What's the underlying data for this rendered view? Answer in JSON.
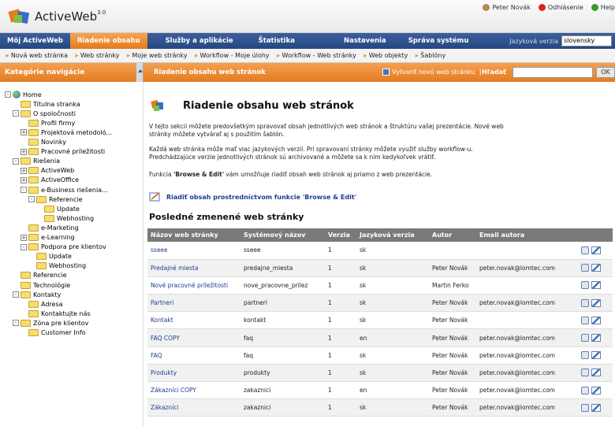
{
  "app": {
    "title": "ActiveWeb",
    "version": "3.0"
  },
  "user": {
    "name": "Peter Novák",
    "logout": "Odhlásenie",
    "help": "Help"
  },
  "main_nav": {
    "tabs": [
      "Môj ActiveWeb",
      "Riadenie obsahu",
      "Služby a aplikácie",
      "Štatistika",
      "Nastavenia",
      "Správa systému"
    ],
    "active": "Riadenie obsahu",
    "lang_label": "Jazyková verzia",
    "lang_value": "slovensky"
  },
  "sub_nav": [
    "Nová web stránka",
    "Web stránky",
    "Moje web stránky",
    "Workflow - Moje úlohy",
    "Workflow - Web stránky",
    "Web objekty",
    "Šablóny"
  ],
  "toolbar": {
    "sidebar_title": "Kategórie navigácie",
    "main_title": "Riadenie obsahu web stránok",
    "create_link": "Vytvoriť novú web stránku",
    "search_label": "Hľadať",
    "ok": "OK"
  },
  "tree": [
    {
      "label": "Home",
      "level": 0,
      "exp": "-"
    },
    {
      "label": "Titulna stranka",
      "level": 1,
      "exp": ""
    },
    {
      "label": "O spoločnosti",
      "level": 1,
      "exp": "-"
    },
    {
      "label": "Profil firmy",
      "level": 2,
      "exp": ""
    },
    {
      "label": "Projektová metodoló...",
      "level": 2,
      "exp": "+"
    },
    {
      "label": "Novinky",
      "level": 2,
      "exp": ""
    },
    {
      "label": "Pracovné príležitosti",
      "level": 2,
      "exp": "+"
    },
    {
      "label": "Riešenia",
      "level": 1,
      "exp": "-"
    },
    {
      "label": "ActiveWeb",
      "level": 2,
      "exp": "+"
    },
    {
      "label": "ActiveOffice",
      "level": 2,
      "exp": "+"
    },
    {
      "label": "e-Business riešenia...",
      "level": 2,
      "exp": "-"
    },
    {
      "label": "Referencie",
      "level": 3,
      "exp": "-"
    },
    {
      "label": "Update",
      "level": 4,
      "exp": ""
    },
    {
      "label": "Webhosting",
      "level": 4,
      "exp": ""
    },
    {
      "label": "e-Marketing",
      "level": 2,
      "exp": ""
    },
    {
      "label": "e-Learning",
      "level": 2,
      "exp": "+"
    },
    {
      "label": "Podpora pre klientov",
      "level": 2,
      "exp": "-"
    },
    {
      "label": "Update",
      "level": 3,
      "exp": ""
    },
    {
      "label": "Webhosting",
      "level": 3,
      "exp": ""
    },
    {
      "label": "Referencie",
      "level": 1,
      "exp": ""
    },
    {
      "label": "Technológie",
      "level": 1,
      "exp": ""
    },
    {
      "label": "Kontakty",
      "level": 1,
      "exp": "-"
    },
    {
      "label": "Adresa",
      "level": 2,
      "exp": ""
    },
    {
      "label": "Kontaktujte nás",
      "level": 2,
      "exp": ""
    },
    {
      "label": "Zóna pre klientov",
      "level": 1,
      "exp": "-"
    },
    {
      "label": "Customer Info",
      "level": 2,
      "exp": ""
    }
  ],
  "content": {
    "heading": "Riadenie obsahu web stránok",
    "p1": "V tejto sekcii môžete predovšetkým spravovať obsah jednotlivých web stránok a štruktúru vašej prezentácie. Nové web stránky môžete vytvárať aj s použitím šablón.",
    "p2": "Každá web stránka môže mať viac jazykových verzií. Pri spravovaní stránky môžete využiť služby workflow-u. Predchádzajúce verzie jednotlivých stránok sú archivované a môžete sa k nim kedykoľvek vrátiť.",
    "p3_pre": "Funkcia ",
    "p3_bold": "'Browse & Edit'",
    "p3_post": " vám umožňuje riadiť obsah web stránok aj priamo z web prezentácie.",
    "browse_link": "Riadiť obsah prostredníctvom funkcie 'Browse & Edit'",
    "recent_title": "Posledné zmenené web stránky"
  },
  "table": {
    "headers": [
      "Názov web stránky",
      "Systémový názov",
      "Verzia",
      "Jazyková verzia",
      "Autor",
      "Email autora"
    ],
    "rows": [
      [
        "sseee",
        "sseee",
        "1",
        "sk",
        "",
        ""
      ],
      [
        "Predajné miesta",
        "predajne_miesta",
        "1",
        "sk",
        "Peter Novák",
        "peter.novak@lomtec.com"
      ],
      [
        "Nové pracovné príležitosti",
        "nove_pracovne_prilez",
        "1",
        "sk",
        "Martin Ferko",
        ""
      ],
      [
        "Partneri",
        "partneri",
        "1",
        "sk",
        "Peter Novák",
        "peter.novak@lomtec.com"
      ],
      [
        "Kontakt",
        "kontakt",
        "1",
        "sk",
        "Peter Novák",
        ""
      ],
      [
        "FAQ COPY",
        "faq",
        "1",
        "en",
        "Peter Novák",
        "peter.novak@lomtec.com"
      ],
      [
        "FAQ",
        "faq",
        "1",
        "sk",
        "Peter Novák",
        "peter.novak@lomtec.com"
      ],
      [
        "Produkty",
        "produkty",
        "1",
        "sk",
        "Peter Novák",
        "peter.novak@lomtec.com"
      ],
      [
        "Zákazníci COPY",
        "zakaznici",
        "1",
        "en",
        "Peter Novák",
        "peter.novak@lomtec.com"
      ],
      [
        "Zákazníci",
        "zakaznici",
        "1",
        "sk",
        "Peter Novák",
        "peter.novak@lomtec.com"
      ]
    ]
  },
  "colors": {
    "accent": "#e57b1d",
    "nav": "#264780",
    "link": "#1b3e8f"
  }
}
